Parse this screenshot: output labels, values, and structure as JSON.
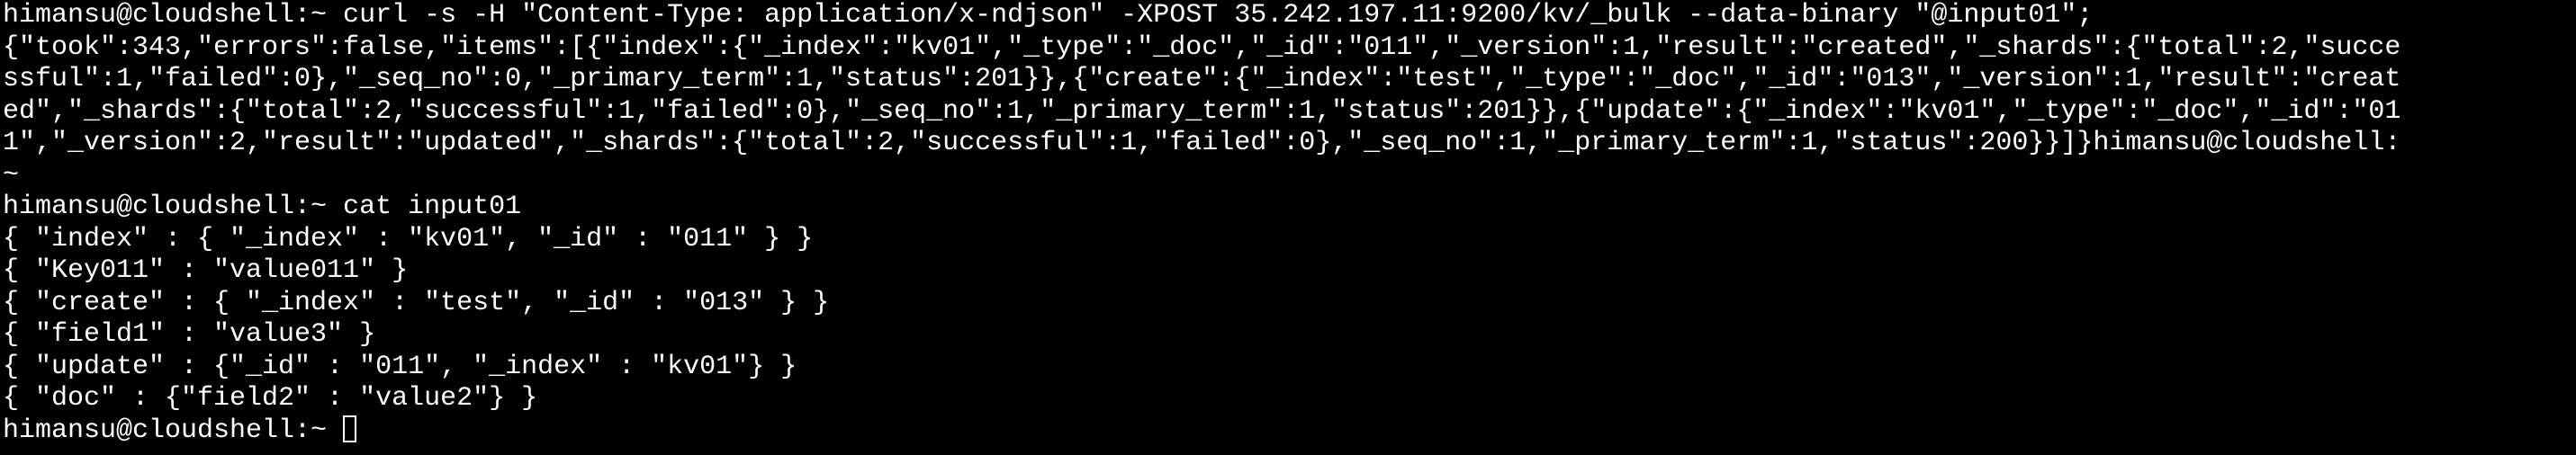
{
  "terminal": {
    "lines": [
      "himansu@cloudshell:~ curl -s -H \"Content-Type: application/x-ndjson\" -XPOST 35.242.197.11:9200/kv/_bulk --data-binary \"@input01\";",
      "{\"took\":343,\"errors\":false,\"items\":[{\"index\":{\"_index\":\"kv01\",\"_type\":\"_doc\",\"_id\":\"011\",\"_version\":1,\"result\":\"created\",\"_shards\":{\"total\":2,\"succe",
      "ssful\":1,\"failed\":0},\"_seq_no\":0,\"_primary_term\":1,\"status\":201}},{\"create\":{\"_index\":\"test\",\"_type\":\"_doc\",\"_id\":\"013\",\"_version\":1,\"result\":\"creat",
      "ed\",\"_shards\":{\"total\":2,\"successful\":1,\"failed\":0},\"_seq_no\":1,\"_primary_term\":1,\"status\":201}},{\"update\":{\"_index\":\"kv01\",\"_type\":\"_doc\",\"_id\":\"01",
      "1\",\"_version\":2,\"result\":\"updated\",\"_shards\":{\"total\":2,\"successful\":1,\"failed\":0},\"_seq_no\":1,\"_primary_term\":1,\"status\":200}}]}himansu@cloudshell:",
      "~",
      "himansu@cloudshell:~ cat input01",
      "{ \"index\" : { \"_index\" : \"kv01\", \"_id\" : \"011\" } }",
      "{ \"Key011\" : \"value011\" }",
      "{ \"create\" : { \"_index\" : \"test\", \"_id\" : \"013\" } }",
      "{ \"field1\" : \"value3\" }",
      "{ \"update\" : {\"_id\" : \"011\", \"_index\" : \"kv01\"} }",
      "{ \"doc\" : {\"field2\" : \"value2\"} }"
    ],
    "prompt": "himansu@cloudshell:~ ",
    "colors": {
      "background": "#000000",
      "foreground": "#ffffff"
    }
  }
}
